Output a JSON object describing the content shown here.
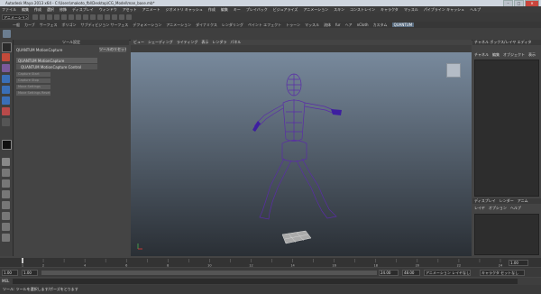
{
  "window": {
    "title": "Autodesk Maya 2013 x64 - C:\\Users\\makoto_fbl\\Desktop\\CG_Model\\man_base.mb*",
    "minimize": "–",
    "maximize": "□",
    "close": "✕"
  },
  "menubar": [
    "ファイル",
    "編集",
    "作成",
    "選択",
    "修飾",
    "ディスプレイ",
    "ウィンドウ",
    "アセット",
    "アニメート",
    "ジオメトリ キャッシュ",
    "作成",
    "編集",
    "キー",
    "プレイバック",
    "ビジュアライズ",
    "アニメーション",
    "スキン",
    "コンストレイン",
    "キャラクタ",
    "マッスル",
    "パイプライン キャッシュ",
    "ヘルプ"
  ],
  "status": {
    "mode": "アニメーション"
  },
  "shelf_tabs": {
    "items": [
      "一般",
      "カーブ",
      "サーフェス",
      "ポリゴン",
      "サブディビジョン サーフェス",
      "デフォメーション",
      "アニメーション",
      "ダイナミクス",
      "レンダリング",
      "ペイント エフェクト",
      "トゥーン",
      "マッスル",
      "流体",
      "fur",
      "ヘア",
      "nCloth",
      "カスタム",
      "QUANTUM"
    ],
    "active_index": 17
  },
  "tool_settings": {
    "header": "ツール設定",
    "reset_button": "ツールのリセット",
    "tool_title": "QUANTUM MotionCapture",
    "section_header": "QUANTUM MotionCapture",
    "subsection": "QUANTUM MotionCapture Control",
    "buttons": [
      "Capture Start",
      "Capture Stop",
      "Move Settings",
      "Move Settings Reset"
    ]
  },
  "viewport": {
    "menu": [
      "ビュー",
      "シェーディング",
      "ライティング",
      "表示",
      "レンダラ",
      "パネル"
    ]
  },
  "channel_box": {
    "header": "チャネル ボックス/レイヤ エディタ",
    "tabs": [
      "チャネル",
      "編集",
      "オブジェクト",
      "表示"
    ],
    "layer_tabs": [
      "ディスプレイ",
      "レンダー",
      "アニム"
    ],
    "layer_menu": [
      "レイヤ",
      "オプション",
      "ヘルプ"
    ]
  },
  "timeline": {
    "start": "1.00",
    "end": "24.00",
    "ticks": [
      "1",
      "2",
      "4",
      "6",
      "8",
      "10",
      "12",
      "14",
      "16",
      "18",
      "20",
      "22",
      "24"
    ]
  },
  "range": {
    "start": "1.00",
    "inner_start": "1.00",
    "inner_end": "24.00",
    "end": "48.00",
    "anim_layer": "アニメーション レイヤなし",
    "character": "キャラクタ セットなし"
  },
  "command": {
    "label": "MEL"
  },
  "help": {
    "text": "ツール: ツールを選択します/ポーズをとります"
  },
  "colors": {
    "joint": "#5a2ca8",
    "accent": "#5a6d80"
  }
}
